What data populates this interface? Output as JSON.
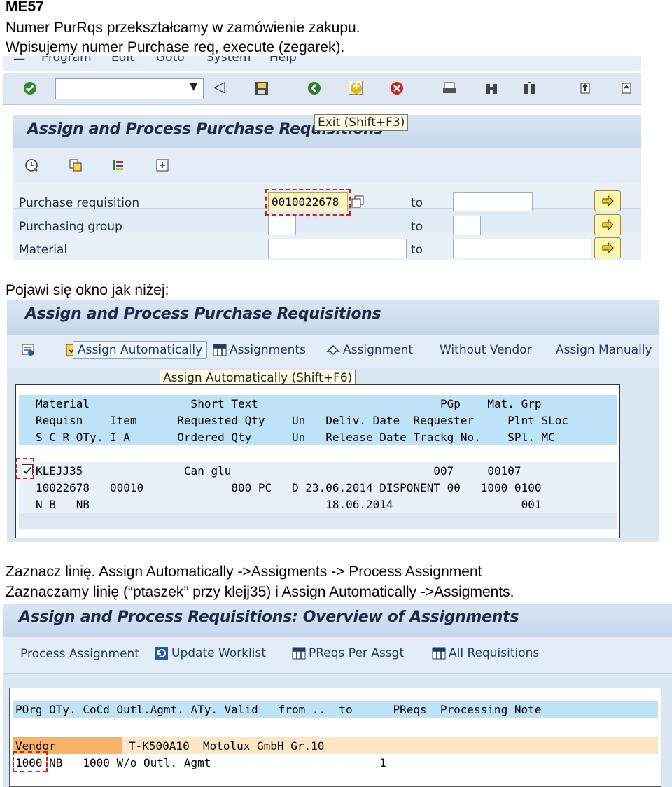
{
  "doc": {
    "heading": "ME57",
    "line1": "Numer PurRqs przekształcamy w zamówienie zakupu.",
    "line2": "Wpisujemy numer Purchase req, execute (zegarek).",
    "between1": "Pojawi się okno jak niżej:",
    "between2a": "Zaznacz linię. Assign Automatically ->Assigments -> Process Assignment",
    "between2b": "Zaznaczamy linię (“ptaszek” przy klejj35) i Assign Automatically ->Assigments."
  },
  "screen1": {
    "menu": [
      "Program",
      "Edit",
      "Goto",
      "System",
      "Help"
    ],
    "title": "Assign and Process Purchase Requisitions",
    "tooltip": "Exit   (Shift+F3)",
    "fields": [
      {
        "label": "Purchase requisition",
        "value": "0010022678",
        "to_label": "to"
      },
      {
        "label": "Purchasing group",
        "value": "",
        "to_label": "to"
      },
      {
        "label": "Material",
        "value": "",
        "to_label": "to"
      }
    ]
  },
  "screen2": {
    "title": "Assign and Process Purchase Requisitions",
    "toolbar": {
      "assign_auto": "Assign Automatically",
      "assignments": "Assignments",
      "assignment": "Assignment",
      "without_vendor": "Without Vendor",
      "assign_manually": "Assign Manually"
    },
    "tooltip": "Assign Automatically   (Shift+F6)",
    "headers": [
      "Material               Short Text                           PGp    Mat. Grp",
      "Requisn    Item      Requested Qty    Un   Deliv. Date  Requester     Plnt SLoc",
      "S C R OTy. I A       Ordered Qty      Un   Release Date Trackg No.    SPl. MC"
    ],
    "rows": [
      "KLEJJ35               Can glu                              007     00107",
      "10022678   00010             800 PC   D 23.06.2014 DISPONENT 00   1000 0100",
      "N B   NB                                   18.06.2014                   001"
    ]
  },
  "screen3": {
    "title": "Assign and Process Requisitions: Overview of Assignments",
    "toolbar": {
      "process": "Process Assignment",
      "update": "Update Worklist",
      "preqs_per": "PReqs Per Assgt",
      "all_req": "All Requisitions"
    },
    "header": "POrg OTy. CoCd Outl.Agmt. ATy. Valid   from ..  to      PReqs  Processing Note",
    "vendor_label": "Vendor",
    "vendor_value": "T-K500A10  Motolux GmbH Gr.10",
    "row": "1000 NB   1000 W/o Outl. Agmt                         1"
  }
}
